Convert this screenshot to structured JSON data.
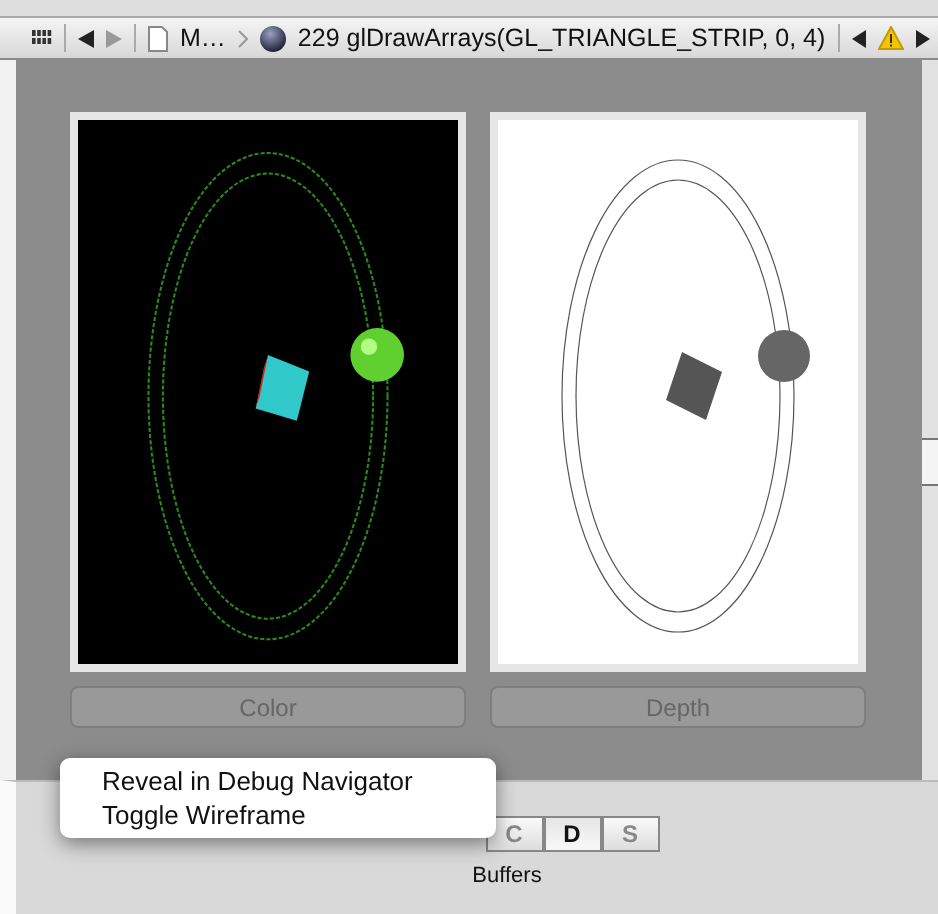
{
  "jump_bar": {
    "file": "M…",
    "call": "229 glDrawArrays(GL_TRIANGLE_STRIP, 0, 4)"
  },
  "buffers": [
    {
      "label": "Color",
      "kind": "color"
    },
    {
      "label": "Depth",
      "kind": "depth"
    }
  ],
  "segments": [
    {
      "label": "C",
      "selected": false
    },
    {
      "label": "D",
      "selected": true
    },
    {
      "label": "S",
      "selected": false
    }
  ],
  "segments_title": "Buffers",
  "context_menu": [
    "Reveal in Debug Navigator",
    "Toggle Wireframe"
  ]
}
